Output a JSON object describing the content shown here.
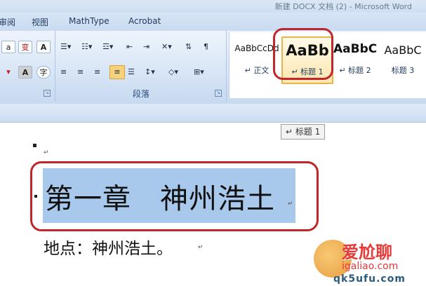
{
  "window": {
    "title": "新建 DOCX 文档 (2) - Microsoft Word"
  },
  "tabs": [
    {
      "label": "审阅"
    },
    {
      "label": "视图"
    },
    {
      "label": "MathType"
    },
    {
      "label": "Acrobat"
    }
  ],
  "ribbon": {
    "font_buttons": [
      "a",
      "变",
      "A",
      "A",
      "字"
    ],
    "paragraph_group": {
      "label": "段落"
    },
    "styles": [
      {
        "sample": "AaBbCcDd",
        "name": "↵ 正文"
      },
      {
        "sample": "AaBb",
        "name": "↵ 标题 1",
        "selected": true
      },
      {
        "sample": "AaBbC",
        "name": "↵ 标题 2"
      },
      {
        "sample": "AaBbC",
        "name": "标题 3"
      }
    ]
  },
  "tooltip": {
    "text": "↵ 标题 1"
  },
  "document": {
    "paragraph_mark": "↵",
    "heading": "第一章　神州浩土",
    "body": "地点：神州浩土。"
  },
  "watermark": {
    "text": "爱尬聊",
    "url": "igaliao.com",
    "lower": "qk5ufu.com"
  },
  "colors": {
    "selection": "#a8c8ec",
    "highlight_ring": "#c0262c",
    "style_selected": "#e8b44a",
    "ribbon": "#d3e2f4"
  }
}
